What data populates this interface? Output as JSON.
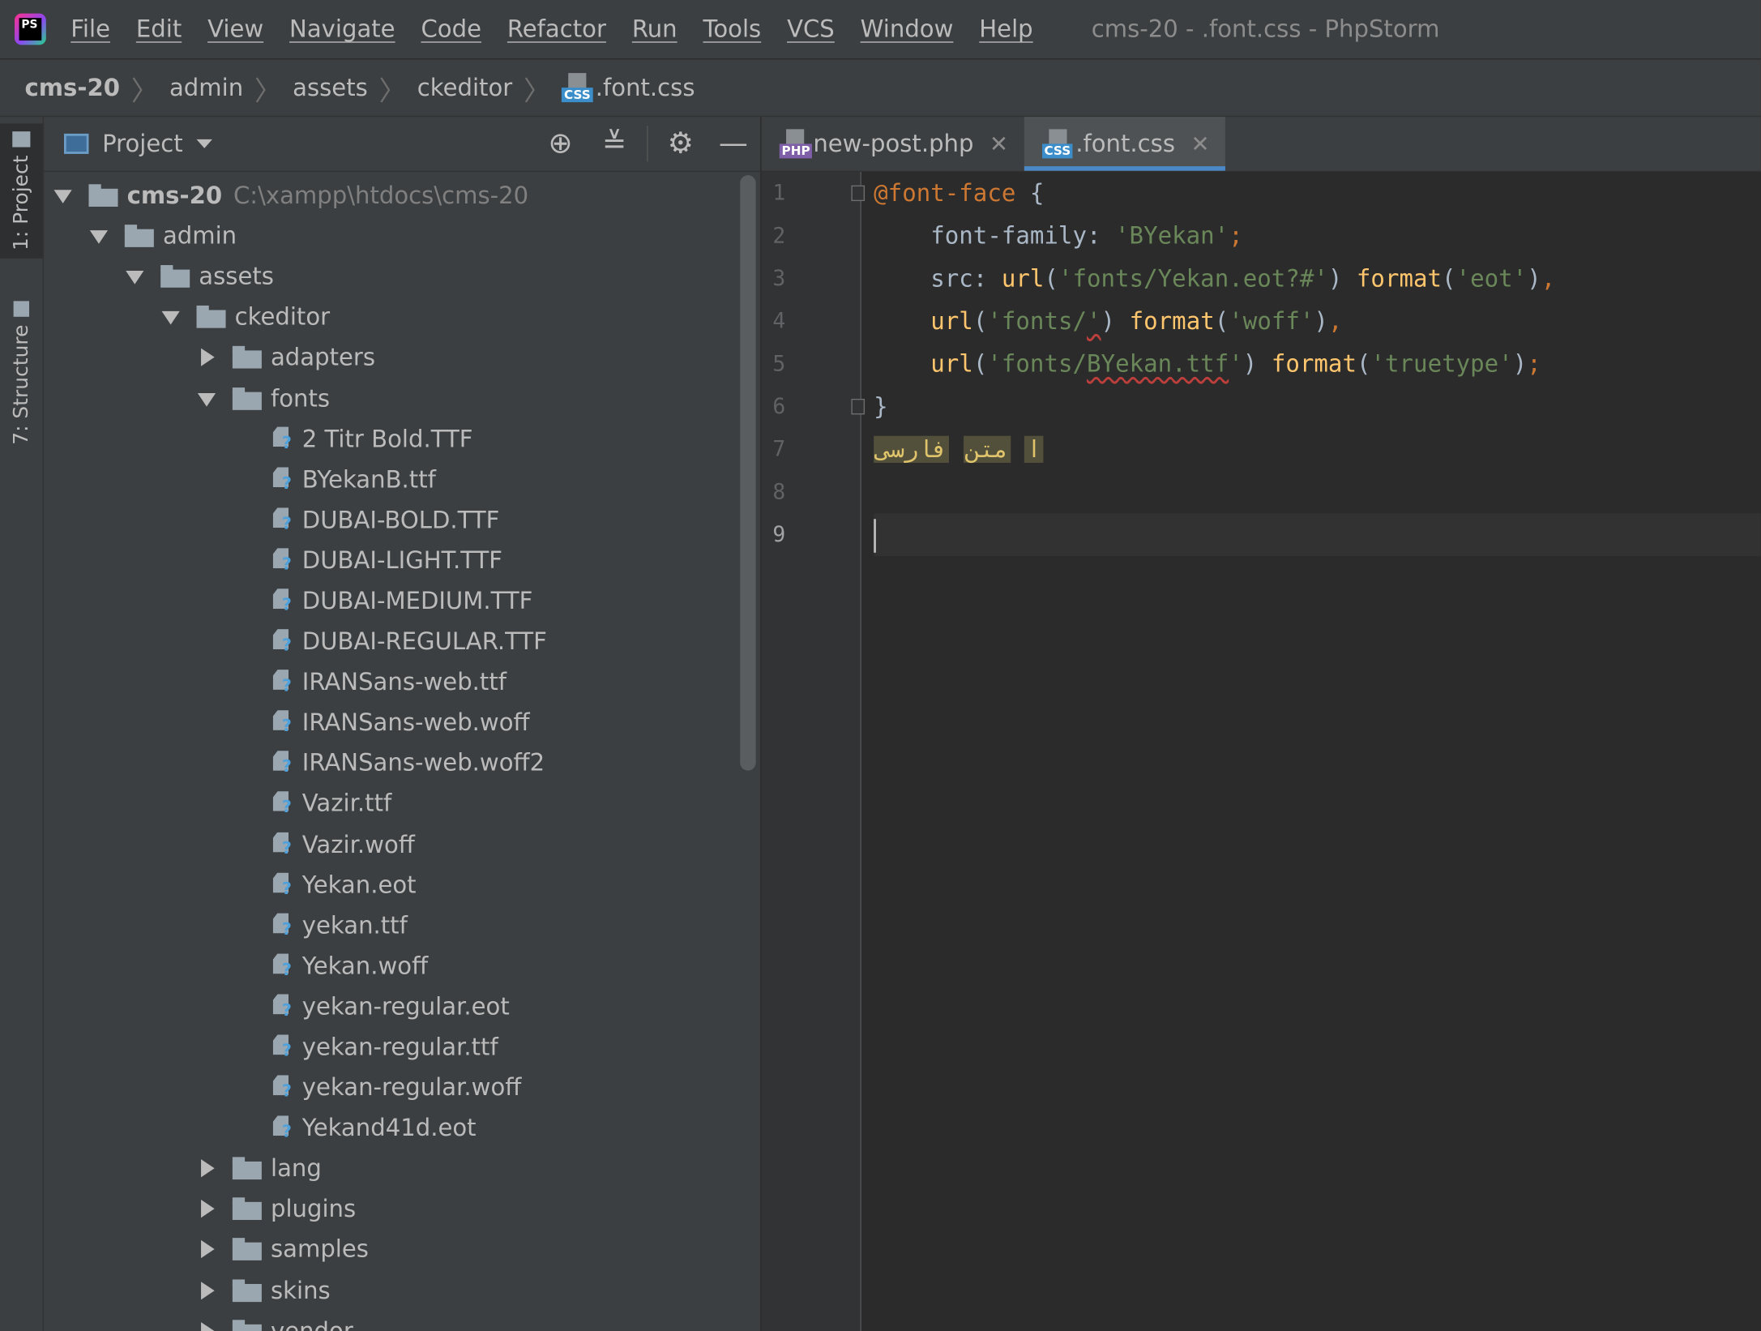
{
  "menubar": {
    "items": [
      "File",
      "Edit",
      "View",
      "Navigate",
      "Code",
      "Refactor",
      "Run",
      "Tools",
      "VCS",
      "Window",
      "Help"
    ],
    "window_title": "cms-20 - .font.css - PhpStorm",
    "logo_text": "PS"
  },
  "breadcrumb": [
    "cms-20",
    "admin",
    "assets",
    "ckeditor",
    ".font.css"
  ],
  "stripe": {
    "project_tab": "1: Project",
    "structure_tab": "7: Structure"
  },
  "project": {
    "title": "Project",
    "root_name": "cms-20",
    "root_path": "C:\\xampp\\htdocs\\cms-20",
    "folders": {
      "admin": "admin",
      "assets": "assets",
      "ckeditor": "ckeditor",
      "adapters": "adapters",
      "fonts": "fonts"
    },
    "font_files": [
      "2 Titr Bold.TTF",
      "BYekanB.ttf",
      "DUBAI-BOLD.TTF",
      "DUBAI-LIGHT.TTF",
      "DUBAI-MEDIUM.TTF",
      "DUBAI-REGULAR.TTF",
      "IRANSans-web.ttf",
      "IRANSans-web.woff",
      "IRANSans-web.woff2",
      "Vazir.ttf",
      "Vazir.woff",
      "Yekan.eot",
      "yekan.ttf",
      "Yekan.woff",
      "yekan-regular.eot",
      "yekan-regular.ttf",
      "yekan-regular.woff",
      "Yekand41d.eot"
    ],
    "after_folders": [
      "lang",
      "plugins",
      "samples",
      "skins",
      "vendor"
    ]
  },
  "editor": {
    "tabs": [
      {
        "label": "new-post.php",
        "icon": "php-file-icon"
      },
      {
        "label": ".font.css",
        "icon": "css-file-icon",
        "active": true
      }
    ],
    "line_numbers": [
      "1",
      "2",
      "3",
      "4",
      "5",
      "6",
      "7",
      "8",
      "9"
    ],
    "current_line": 9,
    "code": {
      "l1_at": "@font-face",
      "l1_brace": " {",
      "l2_prop": "font-family: ",
      "l2_val": "'BYekan'",
      "l2_semi": ";",
      "l3_prop": "src: ",
      "l3_url": "url",
      "l3_arg": "'fonts/Yekan.eot?#'",
      "l3_fmt": "format",
      "l3_fmt_arg": "'eot'",
      "l4_url": "url",
      "l4_arg_a": "'fonts/",
      "l4_arg_b": "'",
      "l4_fmt": "format",
      "l4_fmt_arg": "'woff'",
      "l5_url": "url",
      "l5_arg_a": "'fonts/",
      "l5_arg_b": "BYekan.ttf",
      "l5_arg_c": "'",
      "l5_fmt": "format",
      "l5_fmt_arg": "'truetype'",
      "l6_brace": "}",
      "l7_w1": "ا",
      "l7_w2": "متن",
      "l7_w3": "فارسی"
    }
  }
}
